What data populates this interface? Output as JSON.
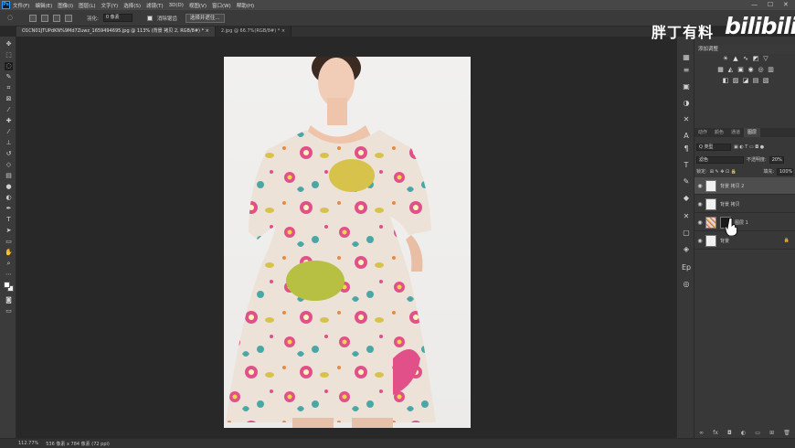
{
  "menu": {
    "logo": "Ps",
    "items": [
      "文件(F)",
      "编辑(E)",
      "图像(I)",
      "图层(L)",
      "文字(Y)",
      "选择(S)",
      "滤镜(T)",
      "3D(D)",
      "视图(V)",
      "窗口(W)",
      "帮助(H)"
    ]
  },
  "window": {
    "minimize": "—",
    "maximize": "☐",
    "close": "✕"
  },
  "options": {
    "feather_label": "羽化:",
    "feather_value": "0 像素",
    "antialias_label": "消除锯齿",
    "select_mask_button": "选择并遮住..."
  },
  "tabs": [
    {
      "label": "O1CN01JTUPdKN%9Md7Zuwz_1659494695.jpg @ 113% (背景 拷贝 2, RGB/8#) *  ×",
      "active": true
    },
    {
      "label": "2.jpg @ 66.7%(RGB/8#) *  ×",
      "active": false
    }
  ],
  "tools": [
    "move-icon",
    "marquee-icon",
    "lasso-icon",
    "quick-select-icon",
    "crop-icon",
    "frame-icon",
    "eyedropper-icon",
    "healing-icon",
    "brush-icon",
    "stamp-icon",
    "history-brush-icon",
    "eraser-icon",
    "gradient-icon",
    "blur-icon",
    "dodge-icon",
    "pen-icon",
    "type-icon",
    "path-select-icon",
    "shape-icon",
    "hand-icon",
    "zoom-icon",
    "more-icon"
  ],
  "status": {
    "zoom": "112.77%",
    "doc_size": "536 像素 x 784 像素 (72 ppi)"
  },
  "adjustments": {
    "title": "添加调整"
  },
  "layers_panel": {
    "tabs": [
      {
        "label": "动作",
        "active": false
      },
      {
        "label": "颜色",
        "active": false
      },
      {
        "label": "通道",
        "active": false
      },
      {
        "label": "图层",
        "active": true
      }
    ],
    "filter_kind": "Q 类型",
    "blend_mode": "滤色",
    "opacity_label": "不透明度:",
    "opacity_value": "20%",
    "lock_label": "锁定:",
    "fill_label": "填充:",
    "fill_value": "100%",
    "layers": [
      {
        "name": "背景 拷贝 2",
        "selected": true,
        "thumb": "white"
      },
      {
        "name": "背景 拷贝",
        "selected": false,
        "thumb": "white"
      },
      {
        "name": "图层 1",
        "selected": false,
        "thumb": "pattern"
      },
      {
        "name": "背景",
        "selected": false,
        "thumb": "white",
        "locked": true
      }
    ]
  },
  "watermark": {
    "text": "胖丁有料",
    "logo": "bilibili"
  },
  "colors": {
    "dress_base": "#ece2d7",
    "pink": "#e2508a",
    "yellow": "#d7c34c",
    "teal": "#4aa7a7",
    "orange": "#e98b3f"
  }
}
